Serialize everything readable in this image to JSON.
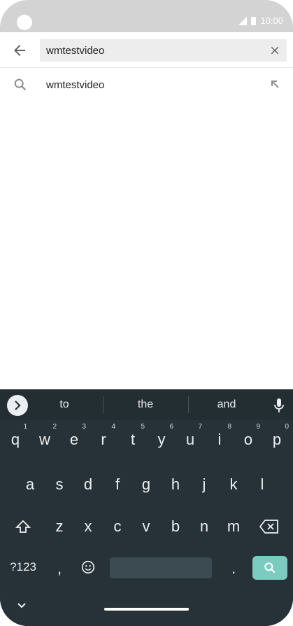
{
  "status_bar": {
    "time": "10:00",
    "icons": [
      "camera-cutout",
      "signal-icon",
      "battery-icon"
    ]
  },
  "search": {
    "query": "wmtestvideo",
    "back_icon": "arrow-back-icon",
    "clear_icon": "close-icon"
  },
  "suggestions": [
    {
      "text": "wmtestvideo",
      "icon": "search-icon",
      "fill_icon": "arrow-up-left-icon"
    }
  ],
  "keyboard": {
    "suggestion_strip": [
      "to",
      "the",
      "and"
    ],
    "row1": [
      {
        "key": "q",
        "hint": "1"
      },
      {
        "key": "w",
        "hint": "2"
      },
      {
        "key": "e",
        "hint": "3"
      },
      {
        "key": "r",
        "hint": "4"
      },
      {
        "key": "t",
        "hint": "5"
      },
      {
        "key": "y",
        "hint": "6"
      },
      {
        "key": "u",
        "hint": "7"
      },
      {
        "key": "i",
        "hint": "8"
      },
      {
        "key": "o",
        "hint": "9"
      },
      {
        "key": "p",
        "hint": "0"
      }
    ],
    "row2": [
      "a",
      "s",
      "d",
      "f",
      "g",
      "h",
      "j",
      "k",
      "l"
    ],
    "row3": [
      "z",
      "x",
      "c",
      "v",
      "b",
      "n",
      "m"
    ],
    "symbols_label": "?123",
    "comma": ",",
    "period": "."
  },
  "colors": {
    "keyboard_bg": "#263238",
    "search_key": "#7ccbc1",
    "status_bar": "#d3d3d3"
  }
}
